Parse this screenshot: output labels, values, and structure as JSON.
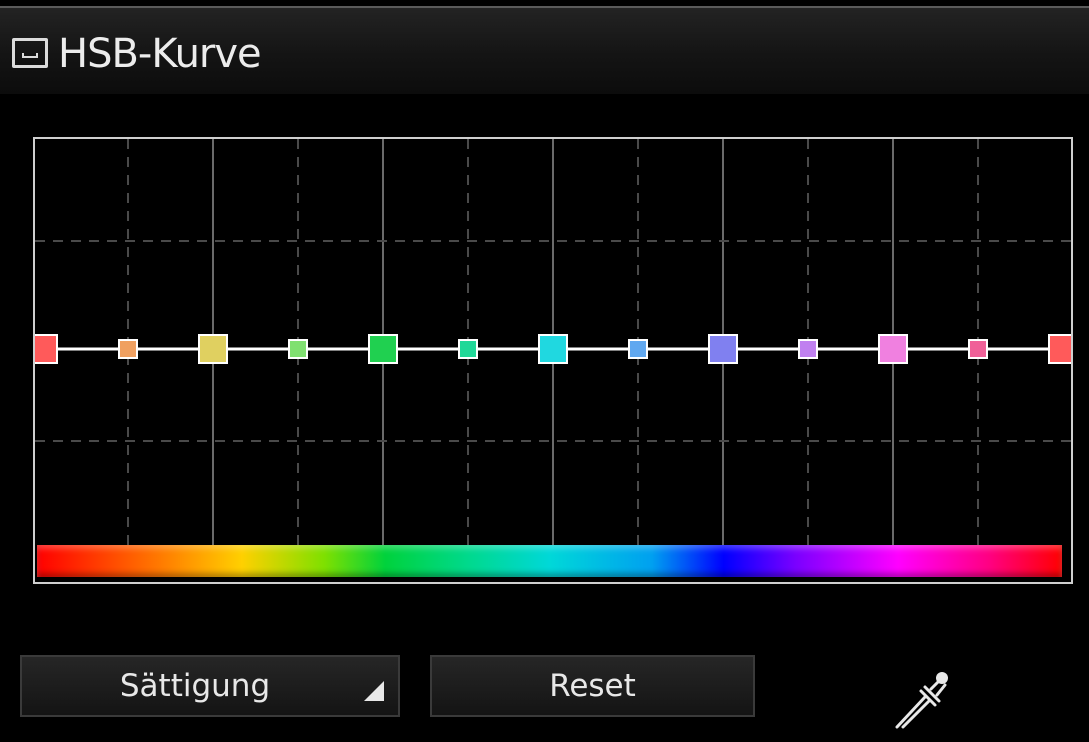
{
  "panel": {
    "title": "HSB-Kurve",
    "title_icon": "window-icon"
  },
  "curve": {
    "grid_color": "#4a4a4a",
    "line_color": "#ffffff",
    "control_points": [
      {
        "hue": 0,
        "value": 0.5,
        "color": "#ff5a5a",
        "size": "large"
      },
      {
        "hue": 30,
        "value": 0.5,
        "color": "#f0a060",
        "size": "small"
      },
      {
        "hue": 60,
        "value": 0.5,
        "color": "#e0d060",
        "size": "large"
      },
      {
        "hue": 90,
        "value": 0.5,
        "color": "#80e070",
        "size": "small"
      },
      {
        "hue": 120,
        "value": 0.5,
        "color": "#20d050",
        "size": "large"
      },
      {
        "hue": 150,
        "value": 0.5,
        "color": "#20d898",
        "size": "small"
      },
      {
        "hue": 180,
        "value": 0.5,
        "color": "#20d8e0",
        "size": "large"
      },
      {
        "hue": 210,
        "value": 0.5,
        "color": "#60a8f0",
        "size": "small"
      },
      {
        "hue": 240,
        "value": 0.5,
        "color": "#8080f0",
        "size": "large"
      },
      {
        "hue": 270,
        "value": 0.5,
        "color": "#c080f0",
        "size": "small"
      },
      {
        "hue": 300,
        "value": 0.5,
        "color": "#f080e0",
        "size": "large"
      },
      {
        "hue": 330,
        "value": 0.5,
        "color": "#f06098",
        "size": "small"
      },
      {
        "hue": 360,
        "value": 0.5,
        "color": "#ff5a5a",
        "size": "large"
      }
    ]
  },
  "controls": {
    "mode_label": "Sättigung",
    "reset_label": "Reset",
    "eyedropper_icon": "eyedropper-icon"
  }
}
